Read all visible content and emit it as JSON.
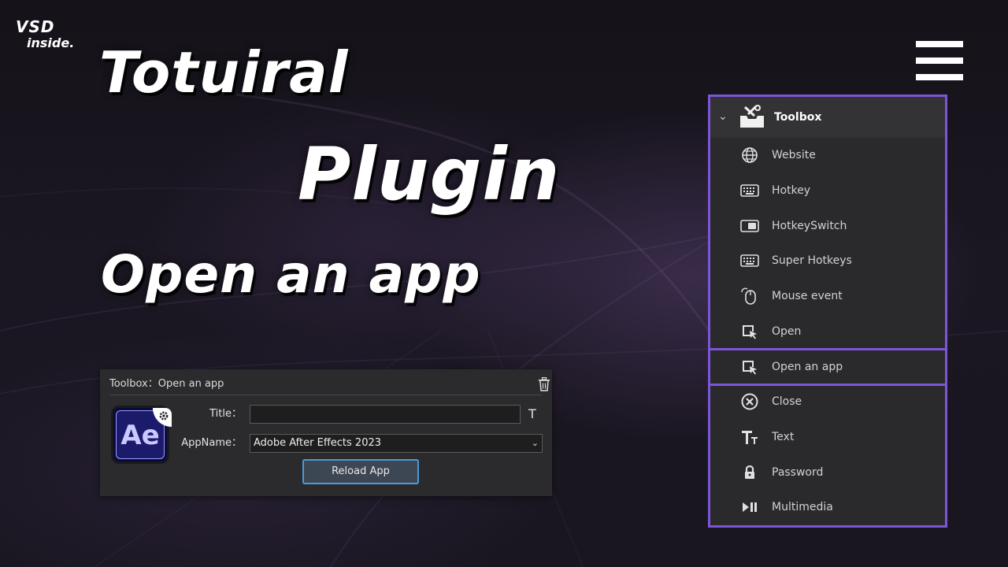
{
  "brand": {
    "mark": "VSD",
    "sub": "inside."
  },
  "headlines": {
    "line1": "Totuiral",
    "line2": "Plugin",
    "line3": "Open an app"
  },
  "editor": {
    "breadcrumb": "Toolbox：Open an app",
    "title_label": "Title：",
    "title_value": "",
    "appname_label": "AppName：",
    "appname_value": "Adobe After Effects 2023",
    "reload_label": "Reload App",
    "app_icon_text": "Ae",
    "text_icon_glyph": "T"
  },
  "toolbox": {
    "title": "Toolbox",
    "items": [
      {
        "label": "Website",
        "icon": "globe-icon"
      },
      {
        "label": "Hotkey",
        "icon": "keyboard-icon"
      },
      {
        "label": "HotkeySwitch",
        "icon": "toggle-icon"
      },
      {
        "label": "Super Hotkeys",
        "icon": "keyboard-icon"
      },
      {
        "label": "Mouse event",
        "icon": "mouse-icon"
      },
      {
        "label": "Open",
        "icon": "cursor-click-icon"
      },
      {
        "label": "Open an app",
        "icon": "cursor-click-icon",
        "selected": true
      },
      {
        "label": "Close",
        "icon": "close-circle-icon"
      },
      {
        "label": "Text",
        "icon": "text-icon"
      },
      {
        "label": "Password",
        "icon": "lock-icon"
      },
      {
        "label": "Multimedia",
        "icon": "play-pause-icon"
      }
    ]
  },
  "colors": {
    "accent_purple": "#7c55d9",
    "button_border": "#4c9ad6",
    "panel_bg": "#2a2a2c"
  }
}
